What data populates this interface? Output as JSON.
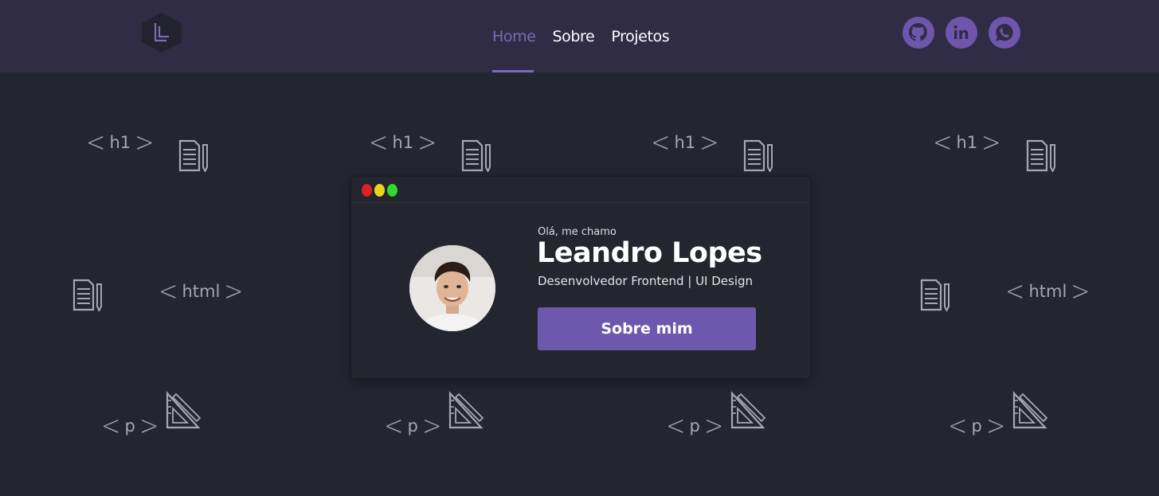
{
  "header": {
    "logo_icon": "hexagon-L-logo",
    "nav": {
      "home": "Home",
      "about": "Sobre",
      "projects": "Projetos"
    },
    "active_item": "Home",
    "socials": [
      {
        "icon": "github-icon"
      },
      {
        "icon": "linkedin-icon"
      },
      {
        "icon": "whatsapp-icon"
      }
    ]
  },
  "background_tags": {
    "h1": "h1",
    "html": "html",
    "p": "p"
  },
  "card": {
    "greeting": "Olá, me chamo",
    "name": "Leandro Lopes",
    "role": "Desenvolvedor Frontend | UI Design",
    "button_label": "Sobre mim",
    "window_dots": [
      "#e3201e",
      "#e9d419",
      "#33d92b"
    ]
  },
  "colors": {
    "accent": "#6f56ad",
    "nav_active": "#7d6ab8",
    "header_bg": "#302c45",
    "page_bg": "#23252f"
  }
}
